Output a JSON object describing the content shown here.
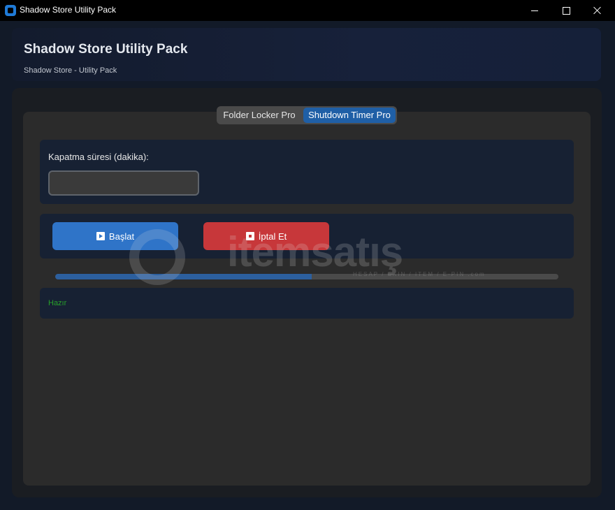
{
  "window": {
    "title": "Shadow Store Utility Pack",
    "controls": [
      "minimize",
      "maximize",
      "close"
    ]
  },
  "header": {
    "title": "Shadow Store Utility Pack",
    "subtitle": "Shadow Store - Utility Pack"
  },
  "tabs": [
    {
      "label": "Folder Locker Pro",
      "active": false
    },
    {
      "label": "Shutdown Timer Pro",
      "active": true
    }
  ],
  "shutdown": {
    "minutes_label": "Kapatma süresi (dakika):",
    "minutes_value": "",
    "start_label": "Başlat",
    "cancel_label": "İptal Et",
    "progress_fraction": 0.51,
    "status_text": "Hazır"
  },
  "watermark": {
    "brand": "itemsatış",
    "tagline": "HESAP / SKIN / ITEM / E-PIN .com"
  },
  "colors": {
    "accent": "#1f5fa6",
    "start_button": "#2f74c8",
    "cancel_button": "#c7373a",
    "status_text": "#27a02a",
    "card": "#172133"
  }
}
